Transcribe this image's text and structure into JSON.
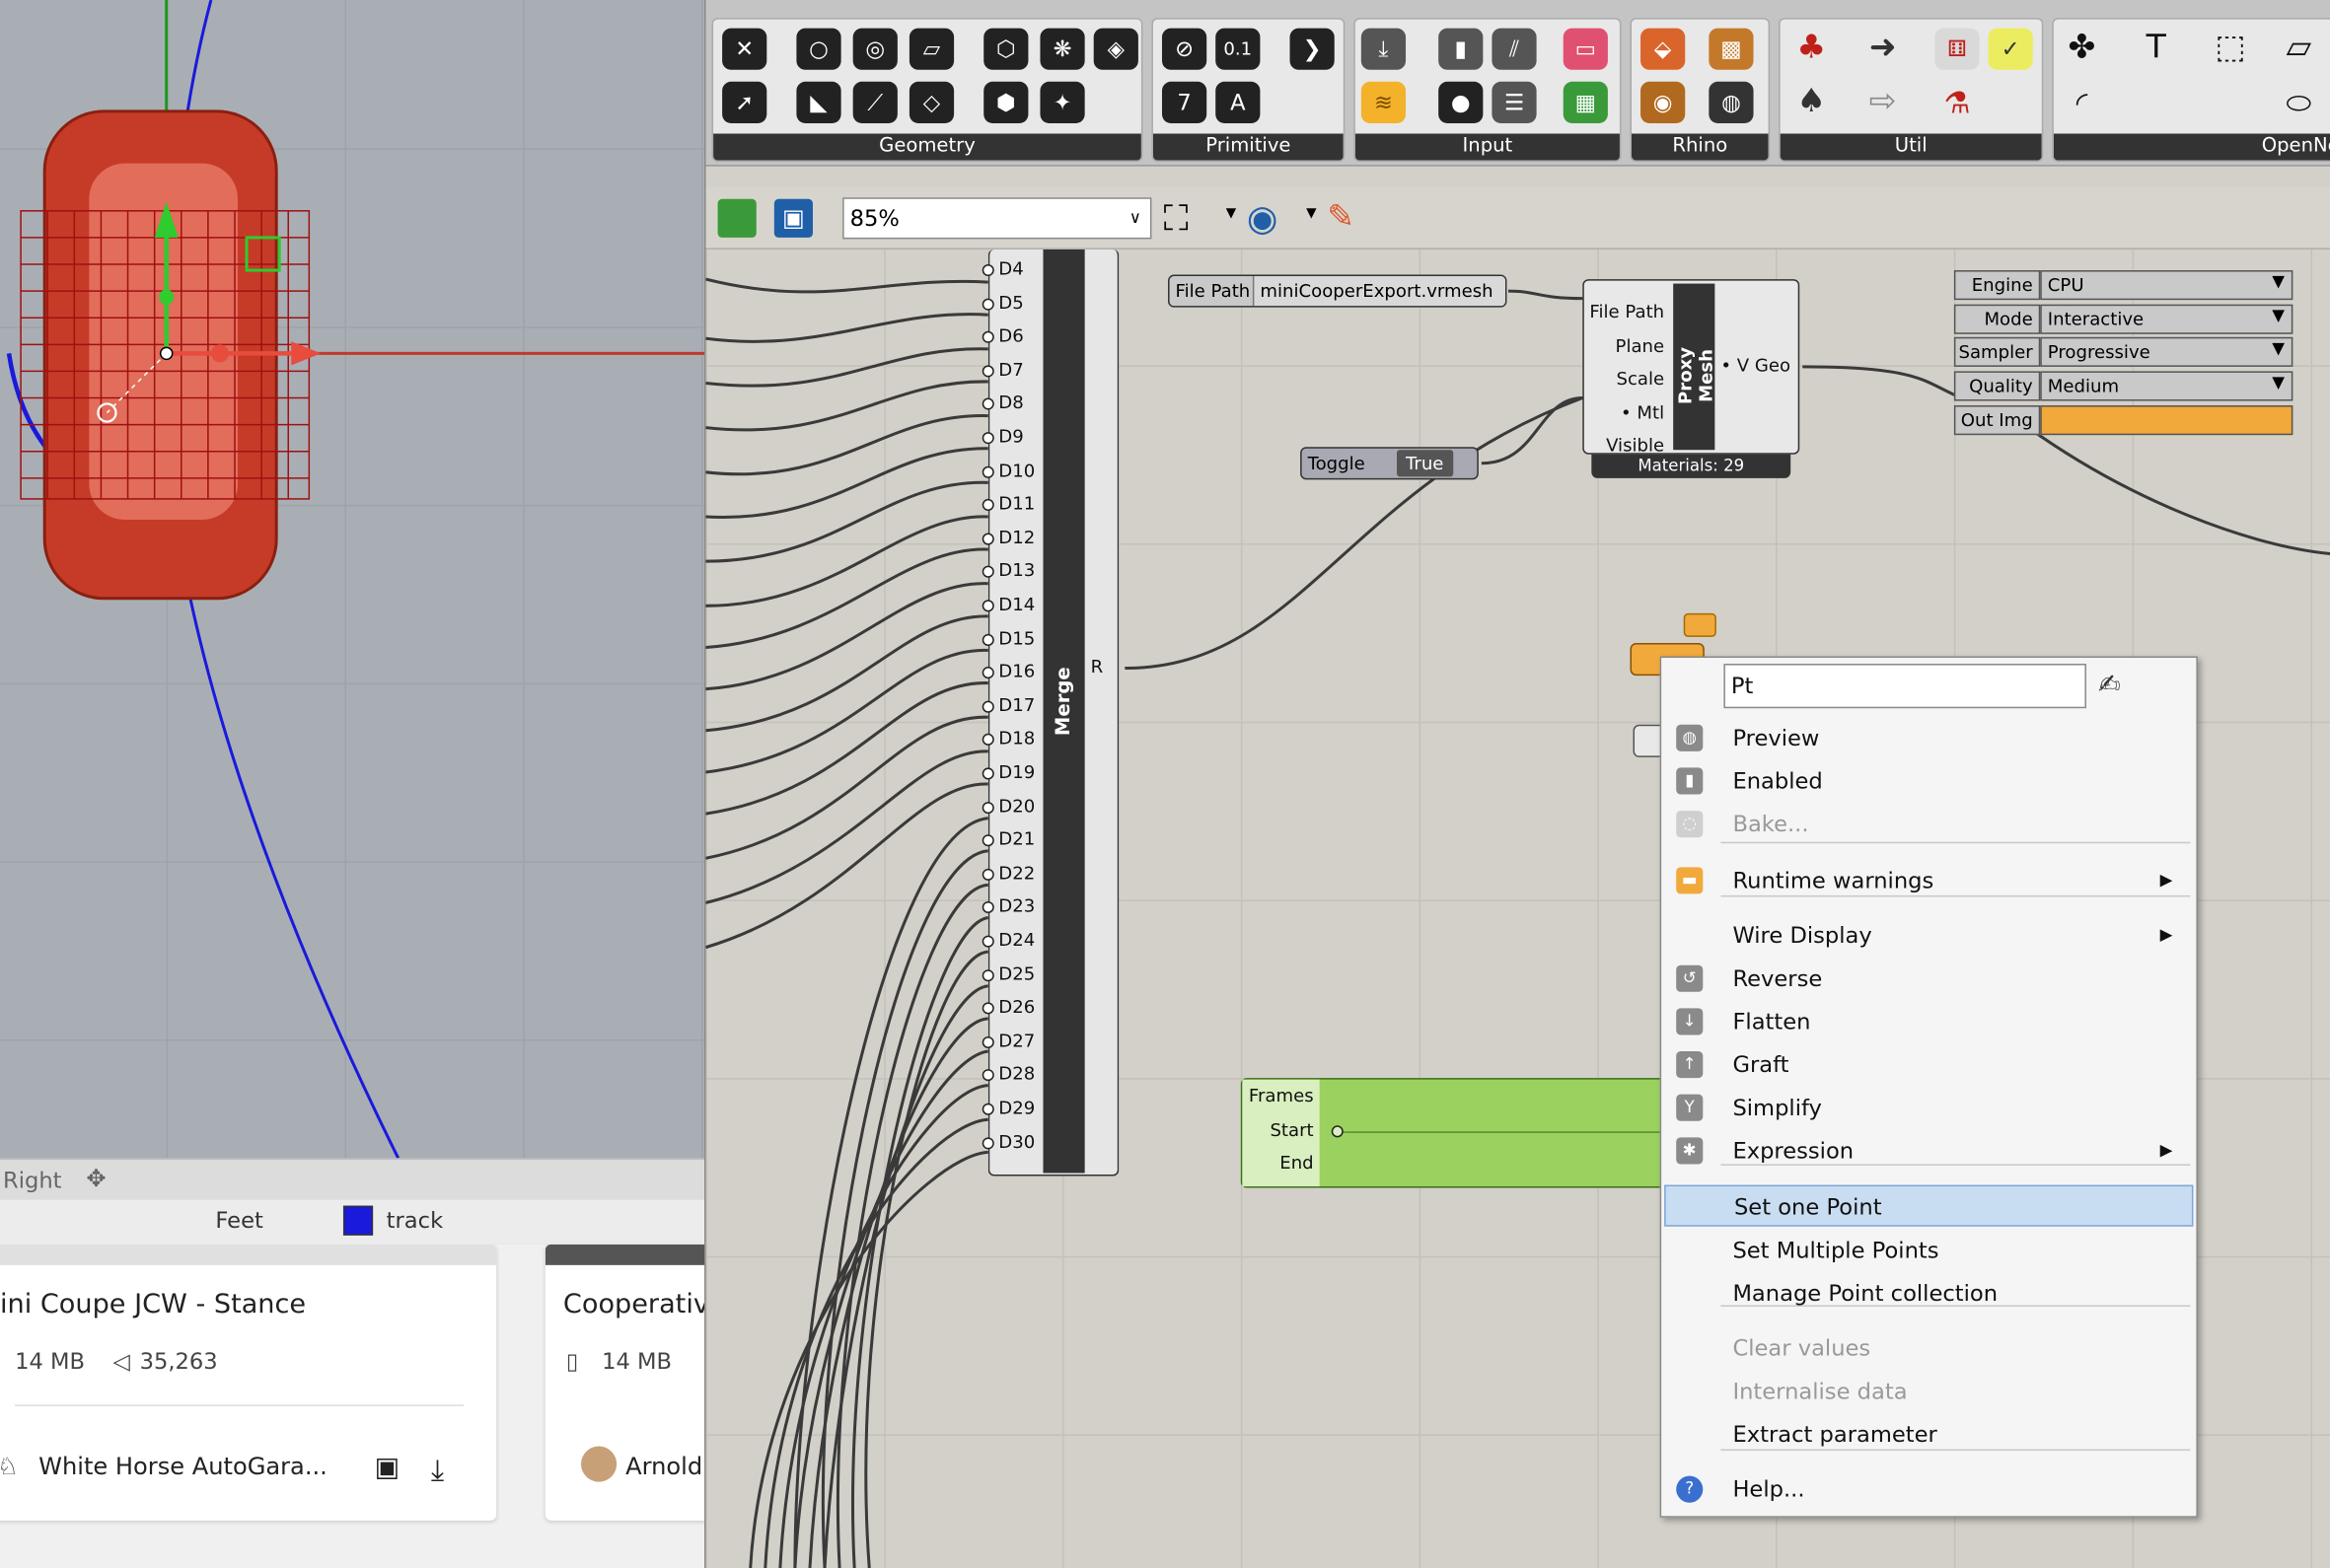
{
  "viewport": {
    "name": "Right",
    "units": "Feet",
    "layer": "track",
    "layer_color": "#1a1adc"
  },
  "cards": [
    {
      "title": "ini Coupe JCW - Stance",
      "size": "14 MB",
      "triangles": "35,263",
      "author": "White Horse AutoGara..."
    },
    {
      "title": "Cooperativ",
      "size": "14 MB",
      "author": "Arnold"
    }
  ],
  "ribbon": {
    "groups": [
      "Geometry",
      "Primitive",
      "Input",
      "Rhino",
      "Util",
      "OpenNe"
    ],
    "primitive_icons": [
      "0.1",
      "7",
      "A"
    ]
  },
  "toolbar": {
    "zoom": "85%"
  },
  "merge": {
    "title": "Merge",
    "output": "R",
    "inputs": [
      "D4",
      "D5",
      "D6",
      "D7",
      "D8",
      "D9",
      "D10",
      "D11",
      "D12",
      "D13",
      "D14",
      "D15",
      "D16",
      "D17",
      "D18",
      "D19",
      "D20",
      "D21",
      "D22",
      "D23",
      "D24",
      "D25",
      "D26",
      "D27",
      "D28",
      "D29",
      "D30"
    ]
  },
  "file_path_param": {
    "label": "File Path",
    "value": "miniCooperExport.vrmesh"
  },
  "toggle_param": {
    "label": "Toggle",
    "value": "True"
  },
  "proxy_mesh": {
    "title": "Proxy Mesh",
    "inputs": [
      "File Path",
      "Plane",
      "Scale",
      "• Mtl",
      "Visible"
    ],
    "output": "• V Geo",
    "footer": "Materials: 29"
  },
  "render_settings": [
    {
      "label": "Engine",
      "value": "CPU"
    },
    {
      "label": "Mode",
      "value": "Interactive"
    },
    {
      "label": "Sampler",
      "value": "Progressive"
    },
    {
      "label": "Quality",
      "value": "Medium"
    },
    {
      "label": "Out Img",
      "value": ""
    }
  ],
  "timeline": {
    "inputs": [
      "Frames",
      "Start",
      "End"
    ]
  },
  "context_menu": {
    "name_value": "Pt",
    "items": [
      {
        "label": "Preview",
        "icon": "preview-icon"
      },
      {
        "label": "Enabled",
        "icon": "enabled-icon"
      },
      {
        "label": "Bake...",
        "icon": "bake-icon",
        "disabled": true
      },
      {
        "label": "Runtime warnings",
        "icon": "warning-icon",
        "submenu": true
      },
      {
        "label": "Wire Display",
        "submenu": true
      },
      {
        "label": "Reverse",
        "icon": "reverse-icon"
      },
      {
        "label": "Flatten",
        "icon": "flatten-icon"
      },
      {
        "label": "Graft",
        "icon": "graft-icon"
      },
      {
        "label": "Simplify",
        "icon": "simplify-icon"
      },
      {
        "label": "Expression",
        "icon": "expression-icon",
        "submenu": true
      },
      {
        "label": "Set one Point",
        "selected": true
      },
      {
        "label": "Set Multiple Points"
      },
      {
        "label": "Manage Point collection"
      },
      {
        "label": "Clear values",
        "disabled": true
      },
      {
        "label": "Internalise data",
        "disabled": true
      },
      {
        "label": "Extract parameter"
      },
      {
        "label": "Help...",
        "icon": "help-icon"
      }
    ]
  }
}
